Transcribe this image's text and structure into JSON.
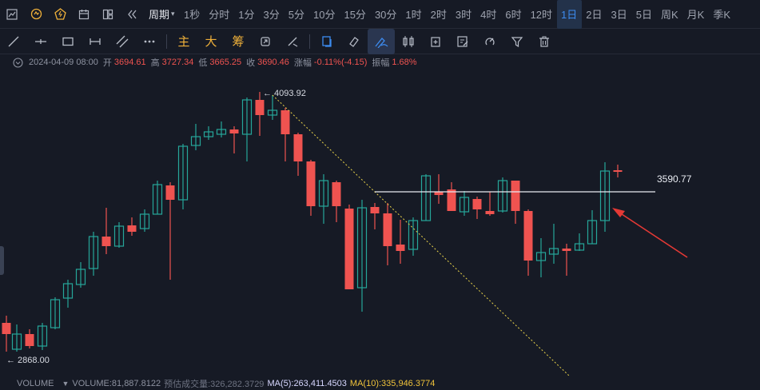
{
  "toolbar": {
    "period_label": "周期",
    "periods": [
      "1秒",
      "分时",
      "1分",
      "3分",
      "5分",
      "10分",
      "15分",
      "30分",
      "1时",
      "2时",
      "3时",
      "4时",
      "6时",
      "12时",
      "1日",
      "2日",
      "3日",
      "5日",
      "周K",
      "月K",
      "季K"
    ],
    "active_period": "1日"
  },
  "drawtools": {
    "text_tools": [
      "主",
      "大",
      "筹"
    ]
  },
  "info": {
    "datetime": "2024-04-09 08:00",
    "open_label": "开",
    "open": "3694.61",
    "high_label": "高",
    "high": "3727.34",
    "low_label": "低",
    "low": "3665.25",
    "close_label": "收",
    "close": "3690.46",
    "change_label": "涨幅",
    "change": "-0.11%(-4.15)",
    "amp_label": "振幅",
    "amp": "1.68%"
  },
  "chart_data": {
    "type": "candlestick",
    "annotations": {
      "high_marker": "← 4093.92",
      "low_marker": "← 2868.00",
      "hline_label": "3590.77"
    },
    "up_color": "#26a69a",
    "down_color": "#ef5350"
  },
  "volume": {
    "title": "VOLUME",
    "volume": "VOLUME:81,887.8122",
    "estimated": "预估成交量:326,282.3729",
    "ma5": "MA(5):263,411.4503",
    "ma10": "MA(10):335,946.3774"
  },
  "colors": {
    "background": "#161a25",
    "accent": "#3d8cf0",
    "ma5": "#d7d7ff",
    "ma10": "#f0c33a"
  }
}
